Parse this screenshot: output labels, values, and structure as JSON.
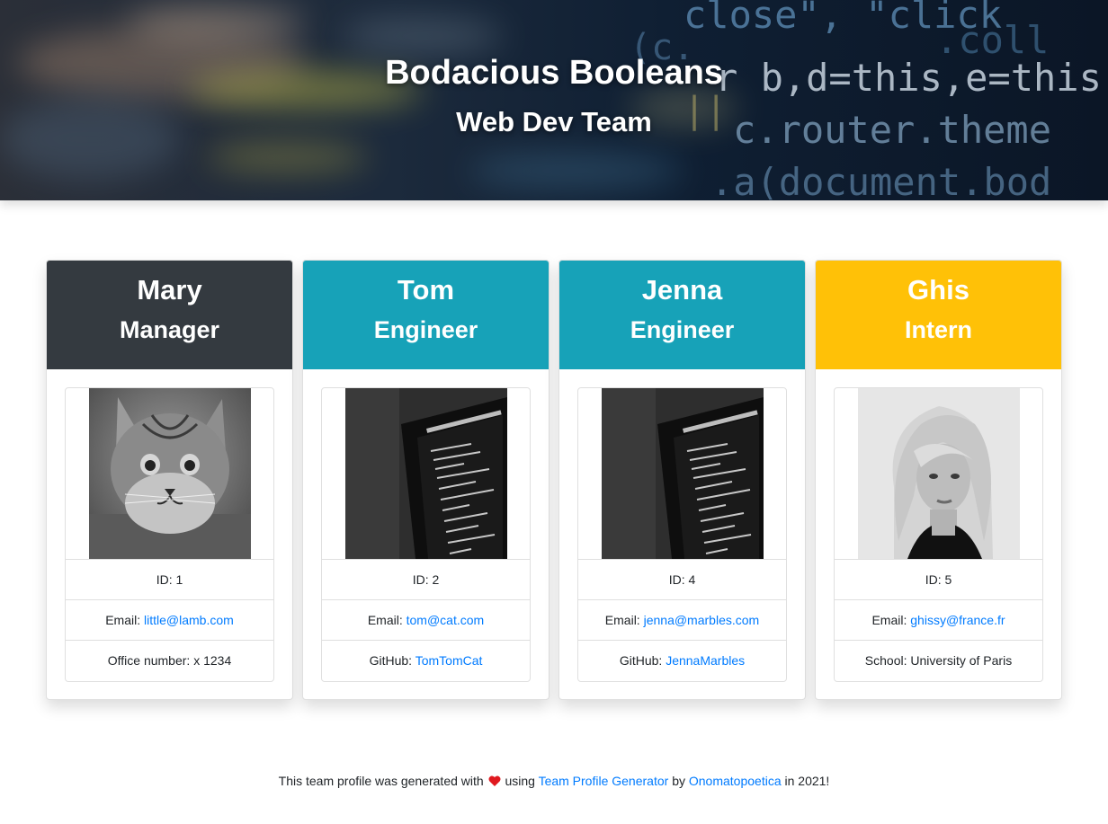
{
  "header": {
    "title": "Bodacious Booleans",
    "subtitle": "Web Dev Team",
    "code_snippets": [
      "close\", \"click",
      ".coll",
      "r b,d=this,e=this",
      "c.router.theme",
      ".a(document.bod",
      "(c.",
      "||"
    ]
  },
  "colors": {
    "manager": "#343a40",
    "engineer": "#17a2b8",
    "intern": "#ffc107",
    "link": "#007bff",
    "heart": "#e0191f"
  },
  "members": [
    {
      "name": "Mary",
      "role": "Manager",
      "photo": "cat-photo",
      "id_label": "ID: 1",
      "email_label": "Email: ",
      "email": "little@lamb.com",
      "extra_label": "Office number: x 1234",
      "extra_link": ""
    },
    {
      "name": "Tom",
      "role": "Engineer",
      "photo": "monitor-code-photo",
      "id_label": "ID: 2",
      "email_label": "Email: ",
      "email": "tom@cat.com",
      "extra_label": "GitHub: ",
      "extra_link": "TomTomCat"
    },
    {
      "name": "Jenna",
      "role": "Engineer",
      "photo": "monitor-code-photo",
      "id_label": "ID: 4",
      "email_label": "Email: ",
      "email": "jenna@marbles.com",
      "extra_label": "GitHub: ",
      "extra_link": "JennaMarbles"
    },
    {
      "name": "Ghis",
      "role": "Intern",
      "photo": "woman-portrait-photo",
      "id_label": "ID: 5",
      "email_label": "Email: ",
      "email": "ghissy@france.fr",
      "extra_label": "School: University of Paris",
      "extra_link": ""
    }
  ],
  "footer": {
    "prefix": "This team profile was generated with",
    "heart_icon": "heart-icon",
    "using": "using",
    "app_link": "Team Profile Generator",
    "by": "by",
    "author_link": "Onomatopoetica",
    "suffix": "in 2021!"
  }
}
